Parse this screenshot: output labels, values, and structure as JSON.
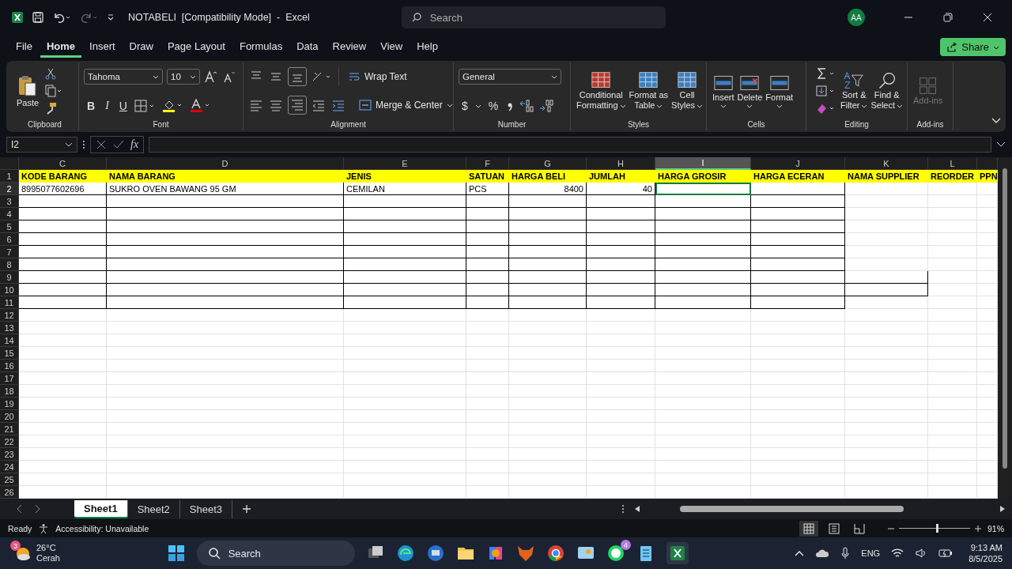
{
  "title_bar": {
    "document": "NOTABELI  [Compatibility Mode]  -  Excel",
    "search_placeholder": "Search",
    "avatar": "AA"
  },
  "menu_tabs": [
    {
      "label": "File",
      "selected": false
    },
    {
      "label": "Home",
      "selected": true
    },
    {
      "label": "Insert",
      "selected": false
    },
    {
      "label": "Draw",
      "selected": false
    },
    {
      "label": "Page Layout",
      "selected": false
    },
    {
      "label": "Formulas",
      "selected": false
    },
    {
      "label": "Data",
      "selected": false
    },
    {
      "label": "Review",
      "selected": false
    },
    {
      "label": "View",
      "selected": false
    },
    {
      "label": "Help",
      "selected": false
    }
  ],
  "share_button": "Share",
  "ribbon": {
    "clipboard": {
      "paste": "Paste",
      "label": "Clipboard"
    },
    "font": {
      "name": "Tahoma",
      "size": "10",
      "bold": "B",
      "italic": "I",
      "underline": "U",
      "label": "Font"
    },
    "alignment": {
      "wrap": "Wrap Text",
      "merge": "Merge & Center",
      "label": "Alignment"
    },
    "number": {
      "format": "General",
      "currency": "$",
      "percent": "%",
      "label": "Number"
    },
    "styles": {
      "items": [
        [
          "Conditional",
          "Formatting"
        ],
        [
          "Format as",
          "Table"
        ],
        [
          "Cell",
          "Styles"
        ]
      ],
      "label": "Styles"
    },
    "cells": {
      "items": [
        "Insert",
        "Delete",
        "Format"
      ],
      "label": "Cells"
    },
    "editing": {
      "items": [
        [
          "Sort &",
          "Filter"
        ],
        [
          "Find &",
          "Select"
        ]
      ],
      "label": "Editing"
    },
    "addins": {
      "item": "Add-ins",
      "disabled": true,
      "label": "Add-ins"
    }
  },
  "formula_bar": {
    "name_box": "I2",
    "fx": "fx"
  },
  "sheet": {
    "columns": [
      {
        "letter": "C",
        "selected": false
      },
      {
        "letter": "D",
        "selected": false
      },
      {
        "letter": "E",
        "selected": false
      },
      {
        "letter": "F",
        "selected": false
      },
      {
        "letter": "G",
        "selected": false
      },
      {
        "letter": "H",
        "selected": false
      },
      {
        "letter": "I",
        "selected": true
      },
      {
        "letter": "J",
        "selected": false
      },
      {
        "letter": "K",
        "selected": false
      },
      {
        "letter": "L",
        "selected": false
      },
      {
        "selected": false
      }
    ],
    "row_numbers": [
      {
        "label": "1",
        "selected": false
      },
      {
        "label": "2",
        "selected": true
      },
      {
        "label": "3",
        "selected": false
      },
      {
        "label": "4",
        "selected": false
      },
      {
        "label": "5",
        "selected": false
      },
      {
        "label": "6",
        "selected": false
      },
      {
        "label": "7",
        "selected": false
      },
      {
        "label": "8",
        "selected": false
      },
      {
        "label": "9",
        "selected": false
      },
      {
        "label": "10",
        "selected": false
      },
      {
        "label": "11",
        "selected": false
      },
      {
        "label": "12",
        "selected": false
      },
      {
        "label": "13",
        "selected": false
      },
      {
        "label": "14",
        "selected": false
      },
      {
        "label": "15",
        "selected": false
      },
      {
        "label": "16",
        "selected": false
      },
      {
        "label": "17",
        "selected": false
      },
      {
        "label": "18",
        "selected": false
      },
      {
        "label": "19",
        "selected": false
      },
      {
        "label": "20",
        "selected": false
      },
      {
        "label": "21",
        "selected": false
      },
      {
        "label": "22",
        "selected": false
      },
      {
        "label": "23",
        "selected": false
      },
      {
        "label": "24",
        "selected": false
      },
      {
        "label": "25",
        "selected": false
      },
      {
        "label": "26",
        "selected": false
      }
    ],
    "rows": [
      {
        "kind": "header",
        "cells": [
          {
            "text": "KODE BARANG",
            "kind": "text"
          },
          {
            "text": "NAMA BARANG",
            "kind": "text"
          },
          {
            "text": "JENIS",
            "kind": "text"
          },
          {
            "text": "SATUAN",
            "kind": "text"
          },
          {
            "text": "HARGA BELI",
            "kind": "text"
          },
          {
            "text": "JUMLAH",
            "kind": "text"
          },
          {
            "text": "HARGA GROSIR",
            "kind": "text"
          },
          {
            "text": "HARGA ECERAN",
            "kind": "text"
          },
          {
            "text": "NAMA SUPPLIER",
            "kind": "text"
          },
          {
            "text": "REORDER",
            "kind": "text"
          },
          {
            "text": "PPN",
            "kind": "text"
          }
        ]
      },
      {
        "kind": "data",
        "cells": [
          {
            "text": "8995077602696",
            "kind": "text"
          },
          {
            "text": "SUKRO OVEN BAWANG 95 GM",
            "kind": "text"
          },
          {
            "text": "CEMILAN",
            "kind": "text"
          },
          {
            "text": "PCS",
            "kind": "text"
          },
          {
            "text": "8400",
            "kind": "number"
          },
          {
            "text": "40",
            "kind": "number"
          }
        ]
      }
    ]
  },
  "sheet_tabs": [
    {
      "label": "Sheet1",
      "selected": true
    },
    {
      "label": "Sheet2",
      "selected": false
    },
    {
      "label": "Sheet3",
      "selected": false
    }
  ],
  "status_bar": {
    "mode": "Ready",
    "accessibility": "Accessibility: Unavailable",
    "zoom": "91%",
    "zoom_slider": {
      "level": 0.52
    }
  },
  "taskbar": {
    "temperature": "26°C",
    "weather": "Cerah",
    "weather_badge": "3",
    "search": "Search",
    "whatsapp_badge": "4",
    "language": "ENG",
    "time": "9:13 AM",
    "date": "8/5/2025"
  }
}
